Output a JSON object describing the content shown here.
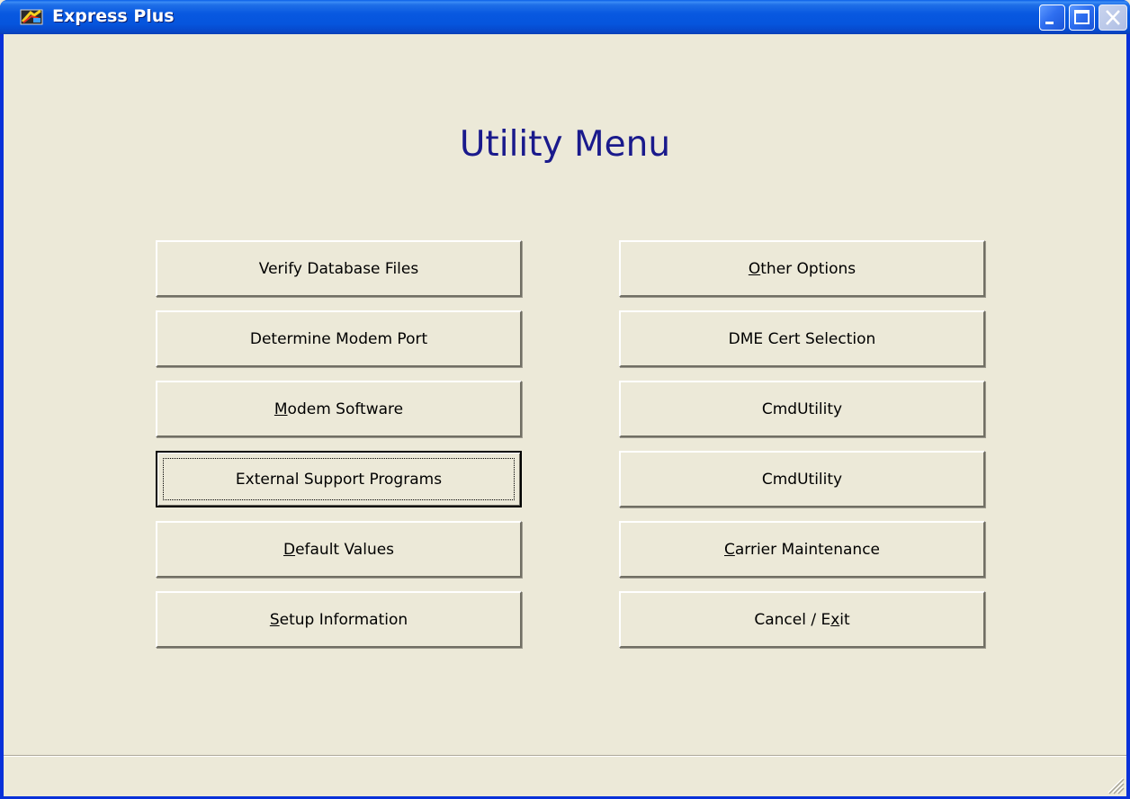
{
  "window": {
    "title": "Express Plus",
    "icon": "express-plus-app-icon"
  },
  "titlebar_buttons": [
    "minimize-icon",
    "maximize-icon",
    "close-icon"
  ],
  "heading": "Utility Menu",
  "buttons_left": [
    {
      "pre": "Verify Database Files",
      "acc": "",
      "post": ""
    },
    {
      "pre": "Determine Modem Port",
      "acc": "",
      "post": ""
    },
    {
      "pre": "",
      "acc": "M",
      "post": "odem Software"
    },
    {
      "pre": "External Support Programs",
      "acc": "",
      "post": ""
    },
    {
      "pre": "",
      "acc": "D",
      "post": "efault Values"
    },
    {
      "pre": "",
      "acc": "S",
      "post": "etup Information"
    }
  ],
  "buttons_right": [
    {
      "pre": "",
      "acc": "O",
      "post": "ther Options"
    },
    {
      "pre": "DME Cert Selection",
      "acc": "",
      "post": ""
    },
    {
      "pre": "CmdUtility",
      "acc": "",
      "post": ""
    },
    {
      "pre": "CmdUtility",
      "acc": "",
      "post": ""
    },
    {
      "pre": "",
      "acc": "C",
      "post": "arrier Maintenance"
    },
    {
      "pre": "Cancel / E",
      "acc": "x",
      "post": "it"
    }
  ],
  "focused_button": "external-support-programs-button",
  "colors": {
    "titlebar": "#0655dd",
    "face": "#ece9d8",
    "heading": "#1a1a8c"
  }
}
